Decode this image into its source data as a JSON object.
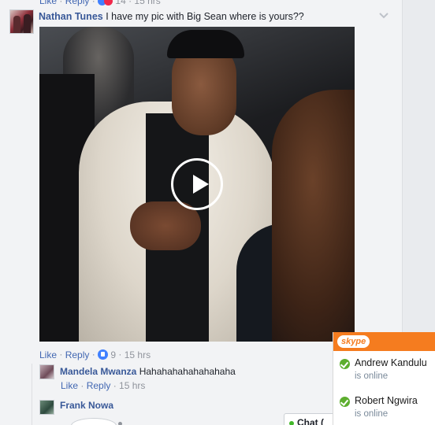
{
  "top_partial": {
    "like": "Like",
    "reply": "Reply",
    "count": "14",
    "time": "15 hrs"
  },
  "comment": {
    "author": "Nathan Tunes",
    "text": "I have my pic with Big Sean where is yours??",
    "actions": {
      "like": "Like",
      "reply": "Reply",
      "like_count": "9",
      "time": "15 hrs"
    }
  },
  "replies": [
    {
      "author": "Mandela Mwanza",
      "text": "Hahahahahahahahaha",
      "like": "Like",
      "reply": "Reply",
      "time": "15 hrs"
    },
    {
      "author": "Frank Nowa",
      "text": ""
    }
  ],
  "chat_tab": {
    "label": "Chat ("
  },
  "skype": {
    "logo": "skype",
    "contacts": [
      {
        "name": "Andrew Kandulu",
        "status": "is online"
      },
      {
        "name": "Robert Ngwira",
        "status": "is online"
      }
    ]
  },
  "colors": {
    "link": "#4267b2",
    "name": "#385898",
    "skype_orange": "#f57c1f",
    "online_green": "#5dae2f"
  },
  "icons": [
    "chevron-down-icon",
    "play-icon",
    "like-icon",
    "online-check-icon"
  ]
}
